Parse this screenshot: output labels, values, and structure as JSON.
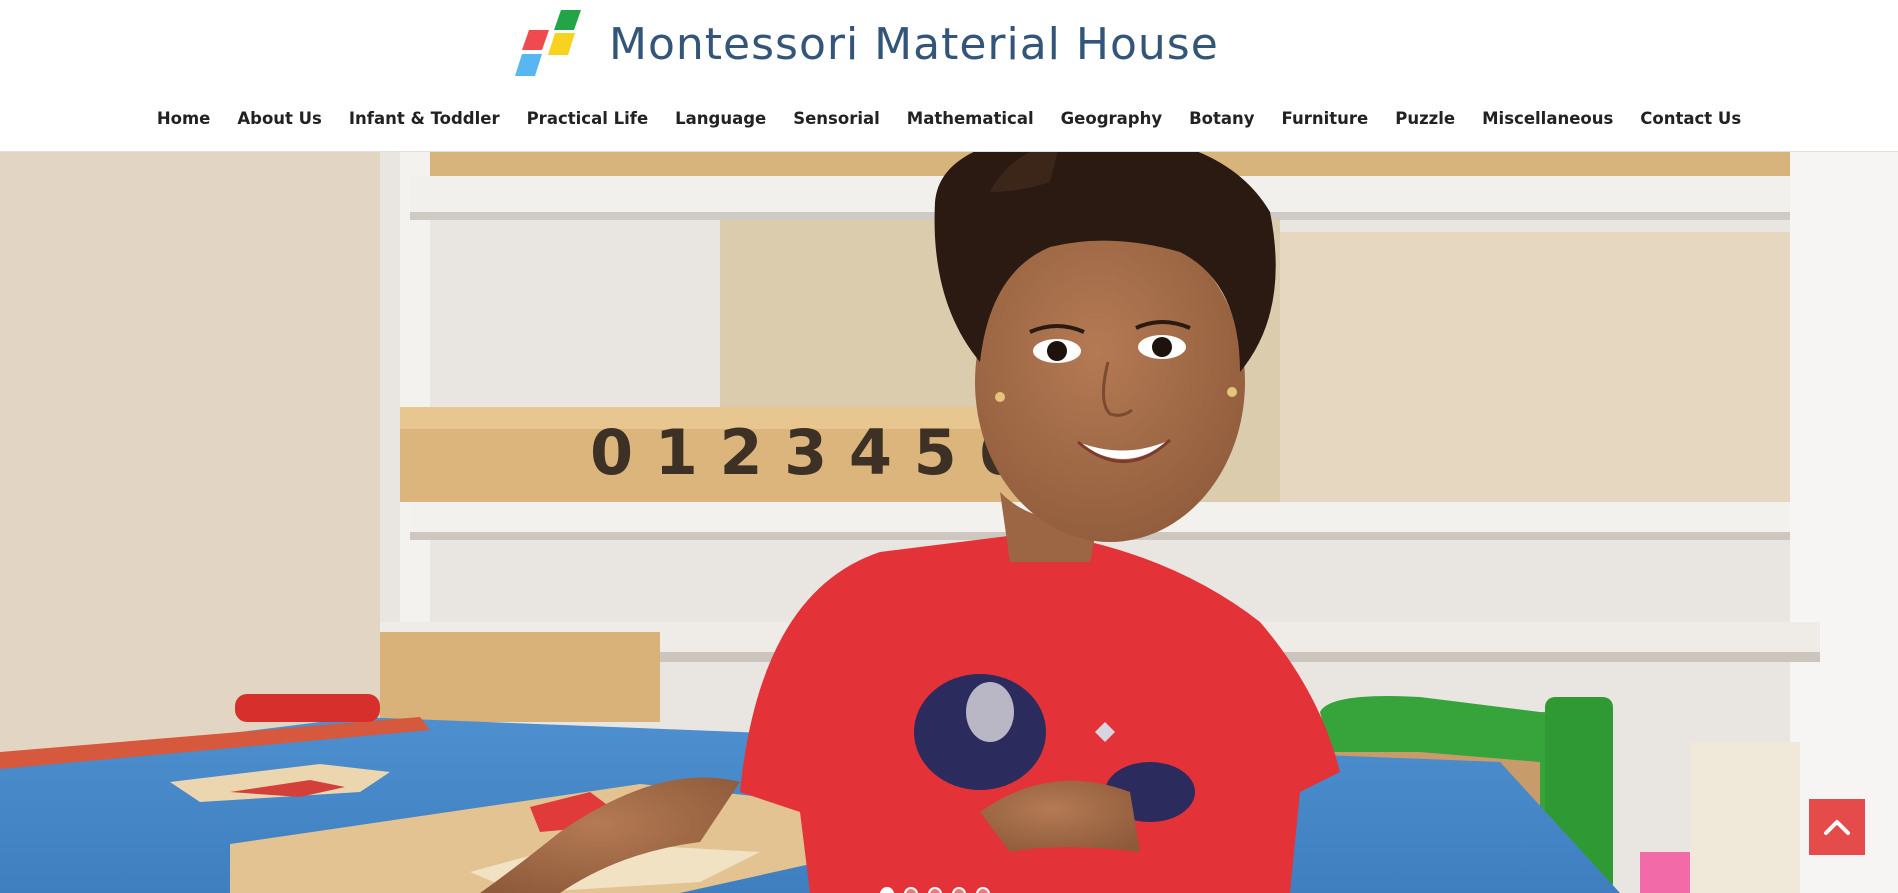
{
  "brand": {
    "name": "Montessori Material House",
    "logo_icon": "colored-parallelogram-logo",
    "colors": {
      "red": "#ef4a4f",
      "green": "#22a447",
      "blue": "#58b7f0",
      "yellow": "#f7d21f",
      "text": "#33557a"
    }
  },
  "nav": {
    "items": [
      {
        "label": "Home"
      },
      {
        "label": "About Us"
      },
      {
        "label": "Infant & Toddler"
      },
      {
        "label": "Practical Life"
      },
      {
        "label": "Language"
      },
      {
        "label": "Sensorial"
      },
      {
        "label": "Mathematical"
      },
      {
        "label": "Geography"
      },
      {
        "label": "Botany"
      },
      {
        "label": "Furniture"
      },
      {
        "label": "Puzzle"
      },
      {
        "label": "Miscellaneous"
      },
      {
        "label": "Contact Us"
      }
    ]
  },
  "hero": {
    "image_icon": "hero-photo",
    "tray_digits": "0 1 2 3 4 5 6 7"
  },
  "slider": {
    "dot_count": 5,
    "active_index": 0
  },
  "scroll_top": {
    "icon": "chevron-up-icon",
    "color": "#e54b4b"
  }
}
